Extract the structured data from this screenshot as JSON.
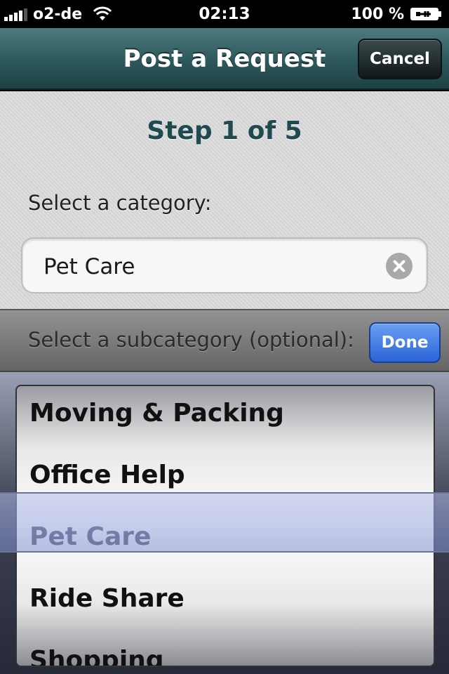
{
  "status_bar": {
    "carrier": "o2-de",
    "time": "02:13",
    "battery": "100 %",
    "signal_icon": "signal-bars-icon",
    "wifi_icon": "wifi-icon",
    "battery_icon": "battery-charging-icon"
  },
  "nav": {
    "title": "Post a Request",
    "cancel_label": "Cancel"
  },
  "form": {
    "step": "Step 1 of 5",
    "category_label": "Select a category:",
    "category_value": "Pet Care",
    "clear_icon": "clear-circle-icon"
  },
  "toolbar": {
    "subcategory_label": "Select a subcategory (optional):",
    "done_label": "Done"
  },
  "picker": {
    "items": [
      "Moving & Packing",
      "Office Help",
      "Pet Care",
      "Ride Share",
      "Shopping"
    ],
    "selected": "Pet Care"
  },
  "colors": {
    "nav_bar": "#2f5a5e",
    "step_title": "#1e4a50",
    "done_button": "#2a64d8"
  }
}
